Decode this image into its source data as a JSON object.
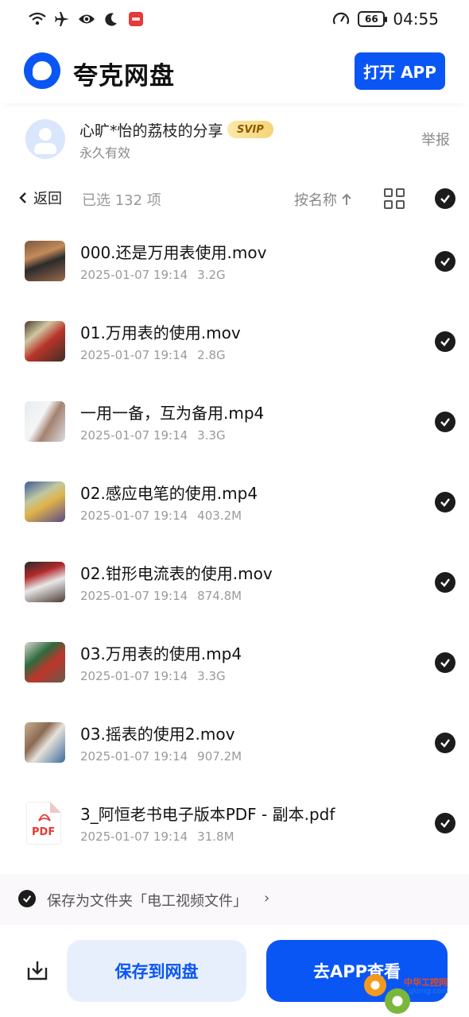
{
  "status_bar": {
    "time": "04:55",
    "battery": "66",
    "icons": [
      "wifi-icon",
      "airplane-icon",
      "eye-icon",
      "moon-icon",
      "app-notification-icon",
      "speed-icon",
      "battery-icon"
    ]
  },
  "header": {
    "app_name": "夸克网盘",
    "open_app_label": "打开 APP",
    "brand_color": "#0a56f5"
  },
  "sharer": {
    "name": "心旷*怡的荔枝的分享",
    "badge": "SVIP",
    "validity": "永久有效",
    "report_label": "举报"
  },
  "toolbar": {
    "back_label": "返回",
    "selected_text": "已选 132 项",
    "sort_label": "按名称"
  },
  "files": [
    {
      "name": "000.还是万用表使用.mov",
      "date": "2025-01-07 19:14",
      "size": "3.2G",
      "type": "video"
    },
    {
      "name": "01.万用表的使用.mov",
      "date": "2025-01-07 19:14",
      "size": "2.8G",
      "type": "video"
    },
    {
      "name": "一用一备，互为备用.mp4",
      "date": "2025-01-07 19:14",
      "size": "3.3G",
      "type": "video"
    },
    {
      "name": "02.感应电笔的使用.mp4",
      "date": "2025-01-07 19:14",
      "size": "403.2M",
      "type": "video"
    },
    {
      "name": "02.钳形电流表的使用.mov",
      "date": "2025-01-07 19:14",
      "size": "874.8M",
      "type": "video"
    },
    {
      "name": "03.万用表的使用.mp4",
      "date": "2025-01-07 19:14",
      "size": "3.3G",
      "type": "video"
    },
    {
      "name": "03.摇表的使用2.mov",
      "date": "2025-01-07 19:14",
      "size": "907.2M",
      "type": "video"
    },
    {
      "name": "3_阿恒老书电子版本PDF - 副本.pdf",
      "date": "2025-01-07 19:14",
      "size": "31.8M",
      "type": "pdf"
    }
  ],
  "pdf_icon_label": "PDF",
  "save_folder": {
    "text": "保存为文件夹「电工视频文件」",
    "chevron": "›"
  },
  "bottom": {
    "save_label": "保存到网盘",
    "goapp_label": "去APP查看"
  },
  "watermark": {
    "text": "中华工控网",
    "sub": "gkong.com"
  }
}
